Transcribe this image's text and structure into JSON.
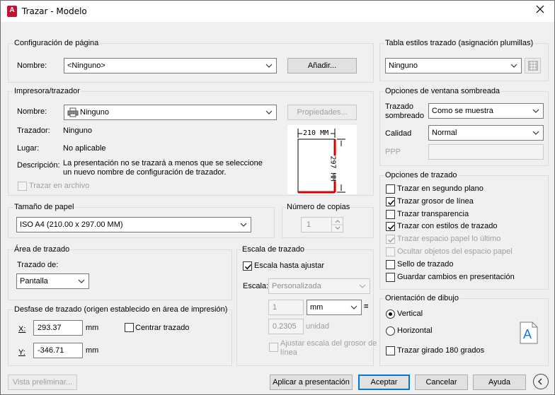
{
  "window": {
    "title": "Trazar - Modelo",
    "app_icon_letter": "A"
  },
  "page_setup": {
    "title": "Configuración de página",
    "name_label": "Nombre:",
    "name_value": "<Ninguno>",
    "add_button": "Añadir..."
  },
  "printer": {
    "title": "Impresora/trazador",
    "name_label": "Nombre:",
    "name_value": "Ninguno",
    "properties_button": "Propiedades...",
    "plotter_label": "Trazador:",
    "plotter_value": "Ninguno",
    "location_label": "Lugar:",
    "location_value": "No aplicable",
    "description_label": "Descripción:",
    "description_line1": "La presentación no se trazará a menos que se seleccione",
    "description_line2": "un nuevo nombre de configuración de trazador.",
    "plot_to_file": "Trazar en archivo",
    "preview_width": "210 MM",
    "preview_height": "297 MM"
  },
  "paper_size": {
    "title": "Tamaño de papel",
    "value": "ISO A4 (210.00 x 297.00 MM)"
  },
  "copies": {
    "title": "Número de copias",
    "value": "1"
  },
  "plot_area": {
    "title": "Área de trazado",
    "what_label": "Trazado de:",
    "what_value": "Pantalla"
  },
  "plot_offset": {
    "title": "Desfase de trazado (origen establecido en área de impresión)",
    "x_label": "X:",
    "x_value": "293.37",
    "x_unit": "mm",
    "y_label": "Y:",
    "y_value": "-346.71",
    "y_unit": "mm",
    "center_label": "Centrar trazado"
  },
  "plot_scale": {
    "title": "Escala de trazado",
    "fit_label": "Escala hasta ajustar",
    "scale_label": "Escala:",
    "scale_value": "Personalizada",
    "val1": "1",
    "unit1": "mm",
    "equals": "=",
    "val2": "0.2305",
    "unit2": "unidad",
    "lineweights_line1": "Ajustar escala del grosor de",
    "lineweights_line2": "línea"
  },
  "style_table": {
    "title": "Tabla estilos trazado (asignación plumillas)",
    "value": "Ninguno"
  },
  "shaded_viewport": {
    "title": "Opciones de ventana sombreada",
    "shade_label1": "Trazado",
    "shade_label2": "sombreado",
    "shade_value": "Como se muestra",
    "quality_label": "Calidad",
    "quality_value": "Normal",
    "dpi_label": "PPP"
  },
  "plot_options": {
    "title": "Opciones de trazado",
    "items": [
      {
        "label": "Trazar en segundo plano",
        "checked": false,
        "disabled": false
      },
      {
        "label": "Trazar grosor de línea",
        "checked": true,
        "disabled": false
      },
      {
        "label": "Trazar transparencia",
        "checked": false,
        "disabled": false
      },
      {
        "label": "Trazar con estilos de trazado",
        "checked": true,
        "disabled": false
      },
      {
        "label": "Trazar espacio papel lo último",
        "checked": true,
        "disabled": true
      },
      {
        "label": "Ocultar objetos del espacio papel",
        "checked": false,
        "disabled": true
      },
      {
        "label": "Sello de trazado",
        "checked": false,
        "disabled": false
      },
      {
        "label": "Guardar cambios en presentación",
        "checked": false,
        "disabled": false
      }
    ]
  },
  "orientation": {
    "title": "Orientación de dibujo",
    "portrait": "Vertical",
    "landscape": "Horizontal",
    "upside_down": "Trazar girado 180 grados",
    "icon_letter": "A"
  },
  "footer": {
    "preview": "Vista preliminar...",
    "apply": "Aplicar a presentación",
    "ok": "Aceptar",
    "cancel": "Cancelar",
    "help": "Ayuda"
  }
}
